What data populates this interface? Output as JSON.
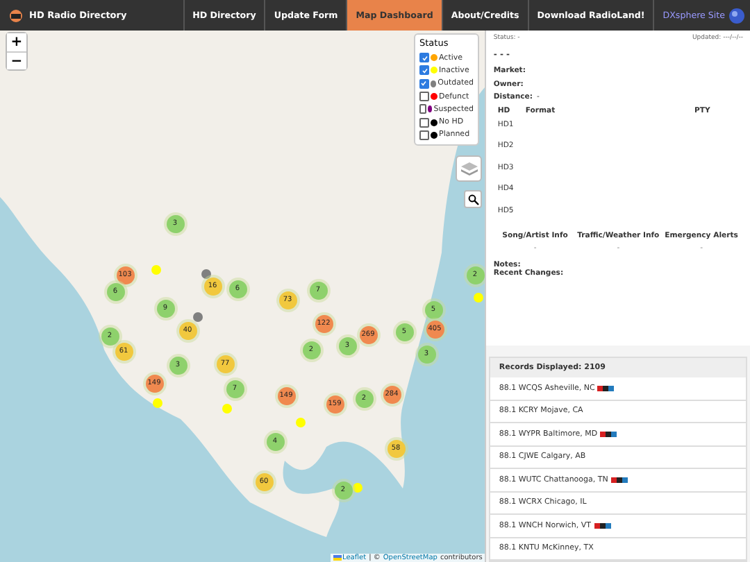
{
  "header": {
    "title": "HD Radio Directory",
    "nav": [
      {
        "label": "HD Directory",
        "selected": false
      },
      {
        "label": "Update Form",
        "selected": false
      },
      {
        "label": "Map Dashboard",
        "selected": true
      },
      {
        "label": "About/Credits",
        "selected": false
      },
      {
        "label": "Download RadioLand!",
        "selected": false
      }
    ],
    "external_link": "DXsphere Site"
  },
  "map": {
    "zoom_in": "+",
    "zoom_out": "−",
    "clusters": [
      {
        "count": "3",
        "color": "#8ed16c"
      },
      {
        "count": "103",
        "color": "#f0894f"
      },
      {
        "count": "2",
        "color": "#8ed16c"
      },
      {
        "count": "6",
        "color": "#8ed16c"
      },
      {
        "count": "16",
        "color": "#f1c83e"
      },
      {
        "count": "6",
        "color": "#8ed16c"
      },
      {
        "count": "7",
        "color": "#8ed16c"
      },
      {
        "count": "9",
        "color": "#8ed16c"
      },
      {
        "count": "73",
        "color": "#f1c83e"
      },
      {
        "count": "5",
        "color": "#8ed16c"
      },
      {
        "count": "2",
        "color": "#8ed16c"
      },
      {
        "count": "40",
        "color": "#f1c83e"
      },
      {
        "count": "122",
        "color": "#f0894f"
      },
      {
        "count": "269",
        "color": "#f0894f"
      },
      {
        "count": "5",
        "color": "#8ed16c"
      },
      {
        "count": "405",
        "color": "#f0894f"
      },
      {
        "count": "61",
        "color": "#f1c83e"
      },
      {
        "count": "2",
        "color": "#8ed16c"
      },
      {
        "count": "3",
        "color": "#8ed16c"
      },
      {
        "count": "3",
        "color": "#8ed16c"
      },
      {
        "count": "3",
        "color": "#8ed16c"
      },
      {
        "count": "77",
        "color": "#f1c83e"
      },
      {
        "count": "149",
        "color": "#f0894f"
      },
      {
        "count": "7",
        "color": "#8ed16c"
      },
      {
        "count": "149",
        "color": "#f0894f"
      },
      {
        "count": "159",
        "color": "#f0894f"
      },
      {
        "count": "2",
        "color": "#8ed16c"
      },
      {
        "count": "284",
        "color": "#f0894f"
      },
      {
        "count": "4",
        "color": "#8ed16c"
      },
      {
        "count": "58",
        "color": "#f1c83e"
      },
      {
        "count": "60",
        "color": "#f1c83e"
      },
      {
        "count": "2",
        "color": "#8ed16c"
      }
    ],
    "points": [
      {
        "color": "#ffff00"
      },
      {
        "color": "#ffff00"
      },
      {
        "color": "#ffff00"
      },
      {
        "color": "#ffff00"
      },
      {
        "color": "#ffff00"
      },
      {
        "color": "#ffff00"
      },
      {
        "color": "#808080"
      },
      {
        "color": "#808080"
      }
    ],
    "legend": {
      "title": "Status",
      "items": [
        {
          "label": "Active",
          "checked": true,
          "color": "#ffa500"
        },
        {
          "label": "Inactive",
          "checked": true,
          "color": "#ffff00"
        },
        {
          "label": "Outdated",
          "checked": true,
          "color": "#808080"
        },
        {
          "label": "Defunct",
          "checked": false,
          "color": "#ff0000"
        },
        {
          "label": "Suspected",
          "checked": false,
          "color": "#800080"
        },
        {
          "label": "No HD",
          "checked": false,
          "color": "#000000"
        },
        {
          "label": "Planned",
          "checked": false,
          "color": "#000000"
        }
      ]
    },
    "attribution": {
      "leaflet": "Leaflet",
      "text": "| ©",
      "osm": "OpenStreetMap",
      "suffix": "contributors"
    }
  },
  "details": {
    "status": "Status: -",
    "updated": "Updated: ---/--/--",
    "callsign": "- - -",
    "fields": [
      {
        "label": "Market:"
      },
      {
        "label": "Owner:"
      },
      {
        "label": "Distance:",
        "value": "-"
      }
    ],
    "hd_columns": [
      "HD",
      "Format",
      "PTY"
    ],
    "hd_rows": [
      "HD1",
      "HD2",
      "HD3",
      "HD4",
      "HD5"
    ],
    "features": [
      {
        "label": "Song/Artist Info",
        "value": "-"
      },
      {
        "label": "Traffic/Weather Info",
        "value": "-"
      },
      {
        "label": "Emergency Alerts",
        "value": "-"
      }
    ],
    "notes_label": "Notes:",
    "changes_label": "Recent Changes:"
  },
  "records": {
    "header": "Records Displayed: 2109",
    "rows": [
      {
        "label": "88.1 WCQS Asheville, NC",
        "npr": true
      },
      {
        "label": "88.1 KCRY Mojave, CA",
        "npr": false
      },
      {
        "label": "88.1 WYPR Baltimore, MD",
        "npr": true
      },
      {
        "label": "88.1 CJWE Calgary, AB",
        "npr": false
      },
      {
        "label": "88.1 WUTC Chattanooga, TN",
        "npr": true
      },
      {
        "label": "88.1 WCRX Chicago, IL",
        "npr": false
      },
      {
        "label": "88.1 WNCH Norwich, VT",
        "npr": true
      },
      {
        "label": "88.1 KNTU McKinney, TX",
        "npr": false
      }
    ]
  }
}
